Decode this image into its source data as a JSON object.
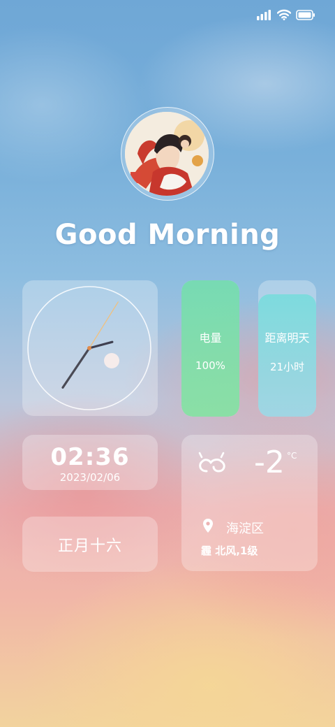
{
  "status_bar": {
    "icons": [
      "signal-icon",
      "wifi-icon",
      "battery-icon"
    ]
  },
  "greeting": "Good Morning",
  "clock": {
    "hour_angle_deg": 214,
    "minute_angle_deg": 75,
    "second_angle_deg": 32
  },
  "battery": {
    "label": "电量",
    "value": "100%",
    "level": 1.0,
    "color": "#7ddba6"
  },
  "tomorrow": {
    "label": "距离明天",
    "value": "21小时",
    "level": 0.9,
    "color": "#86dcdc"
  },
  "datetime": {
    "time": "02:36",
    "date": "2023/02/06"
  },
  "lunar": {
    "text": "正月十六"
  },
  "weather": {
    "icon": "haze-icon",
    "temperature": "-2",
    "unit": "°C",
    "location": "海淀区",
    "condition": "霾 北风,1级"
  }
}
